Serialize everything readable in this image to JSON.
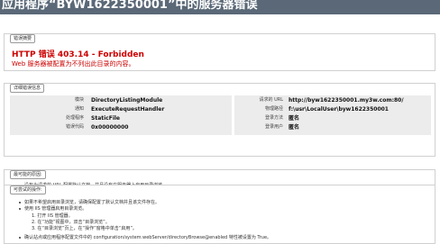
{
  "banner": {
    "title": "应用程序“BYW1622350001”中的服务器错误"
  },
  "error_summary": {
    "title": "错误摘要",
    "heading": "HTTP 错误 403.14 - Forbidden",
    "description": "Web 服务器被配置为不列出此目录的内容。"
  },
  "detail": {
    "title": "详细错误信息",
    "left_rows": [
      {
        "label": "模块",
        "value": "DirectoryListingModule"
      },
      {
        "label": "通知",
        "value": "ExecuteRequestHandler"
      },
      {
        "label": "处理程序",
        "value": "StaticFile"
      },
      {
        "label": "错误代码",
        "value": "0x00000000"
      }
    ],
    "right_rows": [
      {
        "label": "请求的 URL",
        "value": "http://byw1622350001.my3w.com:80/"
      },
      {
        "label": "物理路径",
        "value": "f:\\usr\\LocalUser\\byw1622350001"
      },
      {
        "label": "登录方法",
        "value": "匿名"
      },
      {
        "label": "登录用户",
        "value": "匿名"
      }
    ]
  },
  "causes": {
    "title": "最可能的原因:",
    "items": [
      "没有为请求的 URL 配置默认文档，并且没有在服务器上启用目录浏览。"
    ]
  },
  "solutions": {
    "title": "可尝试的操作:",
    "items": [
      "如果不希望启用目录浏览，请确保配置了默认文档并且该文件存在。",
      "使用 IIS 管理器启用目录浏览。"
    ],
    "steps": [
      "1. 打开 IIS 管理器。",
      "2. 在“功能”视图中，双击“目录浏览”。",
      "3. 在“目录浏览”页上，在“操作”窗格中单击“启用”。"
    ],
    "last_item": "确认站点或应用程序配置文件中的 configuration/system.webServer/directoryBrowse@enabled 特性被设置为 True。"
  }
}
